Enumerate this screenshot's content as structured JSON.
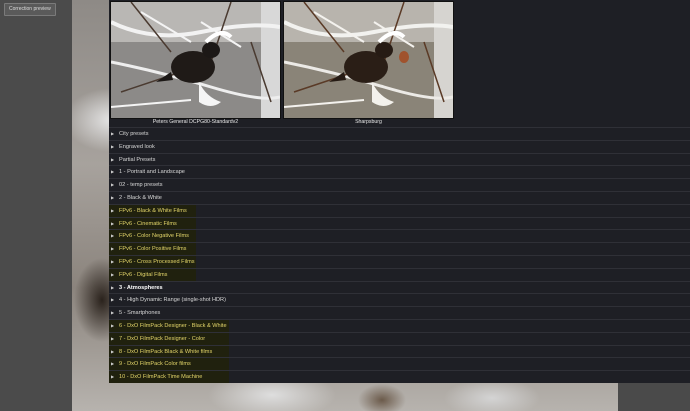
{
  "correction_button": "Correction preview",
  "thumbnails": [
    {
      "caption": "Peters General DCPG80-Standardv2"
    },
    {
      "caption": "Sharpsburg"
    }
  ],
  "presets": [
    {
      "label": "City presets",
      "highlight": false,
      "bold": false
    },
    {
      "label": "Engraved look",
      "highlight": false,
      "bold": false
    },
    {
      "label": "Partial Presets",
      "highlight": false,
      "bold": false
    },
    {
      "label": "1 - Portrait and Landscape",
      "highlight": false,
      "bold": false
    },
    {
      "label": "02 - temp presets",
      "highlight": false,
      "bold": false
    },
    {
      "label": "2 - Black & White",
      "highlight": false,
      "bold": false
    },
    {
      "label": "FPv6 - Black & White Films",
      "highlight": true,
      "bold": false
    },
    {
      "label": "FPv6 - Cinematic Films",
      "highlight": true,
      "bold": false
    },
    {
      "label": "FPv6 - Color Negative Films",
      "highlight": true,
      "bold": false
    },
    {
      "label": "FPv6 - Color Positive Films",
      "highlight": true,
      "bold": false
    },
    {
      "label": "FPv6 - Cross Processed Films",
      "highlight": true,
      "bold": false
    },
    {
      "label": "FPv6 - Digital Films",
      "highlight": true,
      "bold": false
    },
    {
      "label": "3 - Atmospheres",
      "highlight": false,
      "bold": true
    },
    {
      "label": "4 - High Dynamic Range (single-shot HDR)",
      "highlight": false,
      "bold": false
    },
    {
      "label": "5 - Smartphones",
      "highlight": false,
      "bold": false
    },
    {
      "label": "6 - DxO FilmPack Designer - Black & White",
      "highlight": true,
      "bold": false
    },
    {
      "label": "7 - DxO FilmPack Designer - Color",
      "highlight": true,
      "bold": false
    },
    {
      "label": "8 - DxO FilmPack Black & White films",
      "highlight": true,
      "bold": false
    },
    {
      "label": "9 - DxO FilmPack Color films",
      "highlight": true,
      "bold": false
    },
    {
      "label": "10 - DxO FilmPack Time Machine",
      "highlight": true,
      "bold": false
    }
  ],
  "colors": {
    "highlight_text": "#e4d66a",
    "panel_bg": "#1e1f25"
  }
}
